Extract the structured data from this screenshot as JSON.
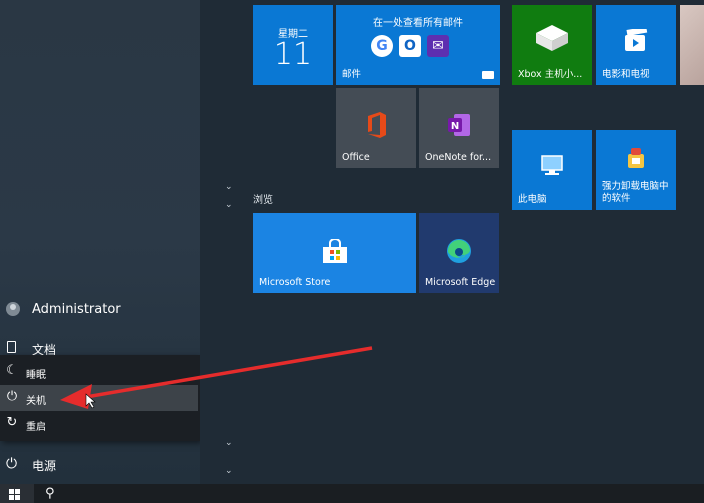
{
  "start_menu": {
    "user": {
      "name": "Administrator"
    },
    "documents_label": "文档",
    "power_label": "电源",
    "power_menu": [
      {
        "label": "睡眠",
        "icon": "moon-icon",
        "selected": false
      },
      {
        "label": "关机",
        "icon": "power-icon",
        "selected": true
      },
      {
        "label": "重启",
        "icon": "restart-icon",
        "selected": false
      }
    ]
  },
  "tiles": {
    "group_label": "浏览",
    "calendar": {
      "weekday": "星期二",
      "day": "11"
    },
    "mail": {
      "title": "在一处查看所有邮件",
      "label": "邮件"
    },
    "office": {
      "label": "Office"
    },
    "onenote": {
      "label": "OneNote for..."
    },
    "xbox": {
      "label": "Xbox 主机小..."
    },
    "movies": {
      "label": "电影和电视"
    },
    "this_pc": {
      "label": "此电脑"
    },
    "uninstaller": {
      "label": "强力卸载电脑中的软件"
    },
    "store": {
      "label": "Microsoft Store"
    },
    "edge": {
      "label": "Microsoft Edge"
    }
  },
  "colors": {
    "tile_blue": "#0a78d4",
    "arrow_red": "#e52c2c"
  }
}
